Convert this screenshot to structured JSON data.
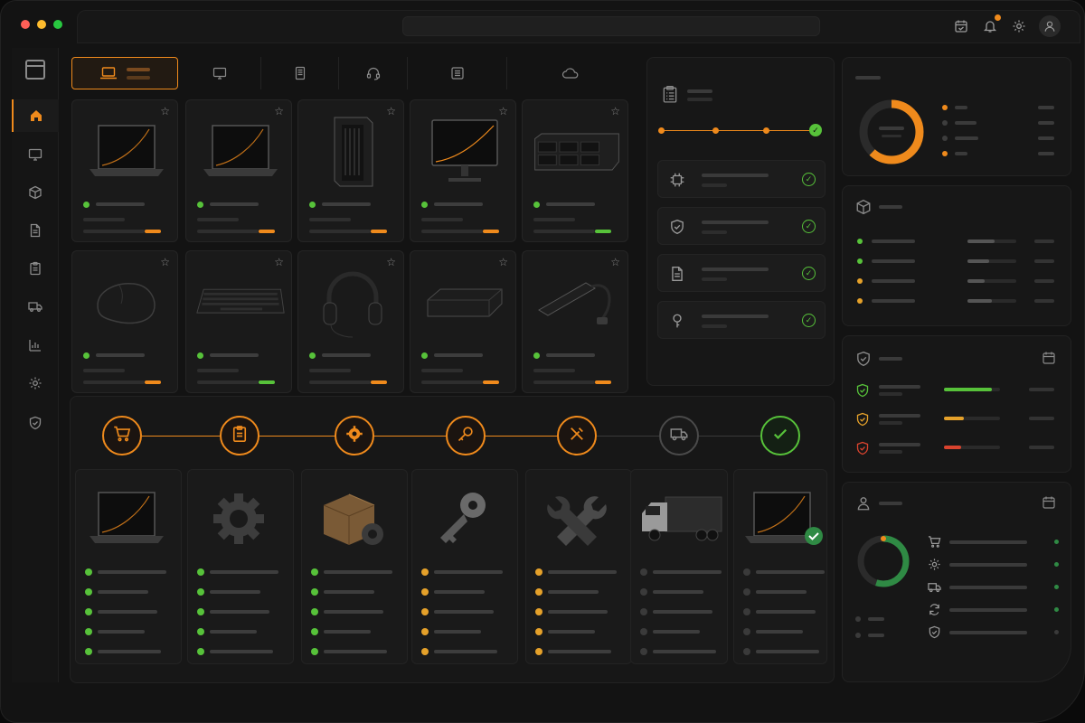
{
  "colors": {
    "accent": "#ef8a1c",
    "ok": "#57c23a",
    "warn": "#e5a12a",
    "danger": "#d9432e",
    "muted": "#3d3d3d"
  },
  "window": {
    "traffic_lights": [
      "#ff5f57",
      "#febc2e",
      "#28c840"
    ]
  },
  "topbar": {
    "icons": [
      "calendar-check-icon",
      "bell-icon",
      "gear-icon",
      "user-icon"
    ]
  },
  "sidebar": {
    "items": [
      "home-icon",
      "monitor-icon",
      "box-icon",
      "document-icon",
      "clipboard-icon",
      "truck-icon",
      "analytics-icon",
      "gear-icon",
      "shield-check-icon"
    ]
  },
  "tabs": [
    "laptop-icon",
    "monitor-icon",
    "server-icon",
    "headset-icon",
    "list-icon",
    "cloud-icon"
  ],
  "products": [
    {
      "icon": "laptop",
      "status": "ok",
      "bar_color": "#ef8a1c"
    },
    {
      "icon": "laptop",
      "status": "ok",
      "bar_color": "#ef8a1c"
    },
    {
      "icon": "tower",
      "status": "ok",
      "bar_color": "#ef8a1c"
    },
    {
      "icon": "monitor",
      "status": "ok",
      "bar_color": "#ef8a1c"
    },
    {
      "icon": "server",
      "status": "ok",
      "bar_color": "#57c23a"
    },
    {
      "icon": "mouse",
      "status": "ok",
      "bar_color": "#ef8a1c"
    },
    {
      "icon": "keyboard",
      "status": "ok",
      "bar_color": "#57c23a"
    },
    {
      "icon": "headphones",
      "status": "ok",
      "bar_color": "#ef8a1c"
    },
    {
      "icon": "minipc",
      "status": "ok",
      "bar_color": "#ef8a1c"
    },
    {
      "icon": "usb-hub",
      "status": "ok",
      "bar_color": "#ef8a1c"
    }
  ],
  "verification": {
    "progress_steps": 4,
    "items": [
      "chip-icon",
      "shield-icon",
      "document-icon",
      "key-icon"
    ]
  },
  "flow": {
    "steps": [
      "cart-icon",
      "clipboard-icon",
      "gear-icon",
      "key-icon",
      "tools-icon",
      "truck-icon",
      "check-icon"
    ],
    "active_count": 5
  },
  "stages": [
    {
      "icon": "laptop",
      "checks": [
        "ok",
        "ok",
        "ok",
        "ok",
        "ok"
      ]
    },
    {
      "icon": "gear",
      "checks": [
        "ok",
        "ok",
        "ok",
        "ok",
        "ok"
      ]
    },
    {
      "icon": "box",
      "checks": [
        "ok",
        "ok",
        "ok",
        "ok",
        "ok"
      ]
    },
    {
      "icon": "key",
      "checks": [
        "warn",
        "warn",
        "warn",
        "warn",
        "warn"
      ]
    },
    {
      "icon": "wrench",
      "checks": [
        "warn",
        "warn",
        "warn",
        "warn",
        "warn"
      ]
    },
    {
      "icon": "truck",
      "checks": [
        "idle",
        "idle",
        "idle",
        "idle",
        "idle"
      ]
    },
    {
      "icon": "laptop-check",
      "checks": [
        "idle",
        "idle",
        "idle",
        "idle",
        "idle"
      ]
    }
  ],
  "donut": {
    "progress": 0.62,
    "legend": [
      "accent",
      "muted",
      "muted",
      "accent"
    ]
  },
  "inventory": {
    "rows": [
      {
        "dot": "ok",
        "fill": 0.55
      },
      {
        "dot": "ok",
        "fill": 0.45
      },
      {
        "dot": "warn",
        "fill": 0.35
      },
      {
        "dot": "warn",
        "fill": 0.5
      }
    ]
  },
  "security": {
    "rows": [
      {
        "level": "ok",
        "fill": 0.85
      },
      {
        "level": "warn",
        "fill": 0.35
      },
      {
        "level": "danger",
        "fill": 0.3
      }
    ]
  },
  "delivery": {
    "progress": 0.55,
    "items": [
      "cart-icon",
      "gear-icon",
      "truck-icon",
      "sync-icon",
      "shield-icon"
    ]
  }
}
